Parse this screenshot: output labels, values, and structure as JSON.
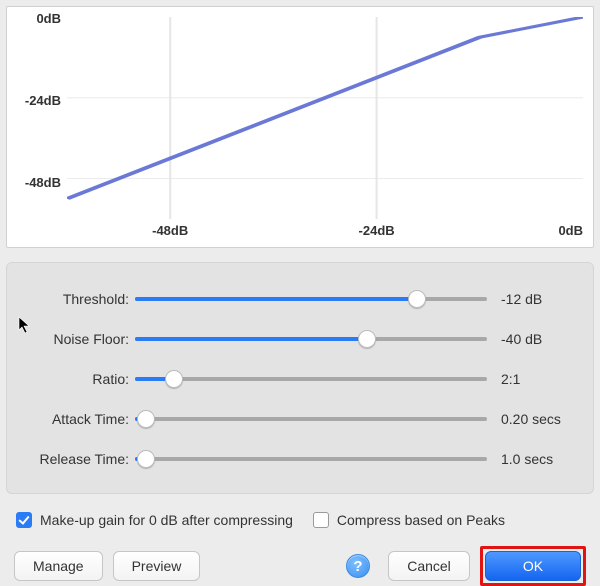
{
  "graph": {
    "y_ticks": [
      "0dB",
      "-24dB",
      "-48dB"
    ],
    "x_ticks": [
      "-48dB",
      "-24dB",
      "0dB"
    ],
    "x_range": [
      -60,
      0
    ],
    "y_range": [
      -60,
      0
    ],
    "line_points": [
      {
        "x": -60,
        "y": -54
      },
      {
        "x": -12,
        "y": -6
      },
      {
        "x": 0,
        "y": 0
      }
    ]
  },
  "sliders": [
    {
      "id": "threshold",
      "label": "Threshold:",
      "value_text": "-12 dB",
      "fill_pct": 80,
      "thumb_pct": 80
    },
    {
      "id": "noise-floor",
      "label": "Noise Floor:",
      "value_text": "-40 dB",
      "fill_pct": 66,
      "thumb_pct": 66
    },
    {
      "id": "ratio",
      "label": "Ratio:",
      "value_text": "2:1",
      "fill_pct": 11,
      "thumb_pct": 11
    },
    {
      "id": "attack-time",
      "label": "Attack Time:",
      "value_text": "0.20 secs",
      "fill_pct": 3,
      "thumb_pct": 3
    },
    {
      "id": "release-time",
      "label": "Release Time:",
      "value_text": "1.0 secs",
      "fill_pct": 3,
      "thumb_pct": 3
    }
  ],
  "checks": {
    "makeup": {
      "label": "Make-up gain for 0 dB after compressing",
      "checked": true
    },
    "peaks": {
      "label": "Compress based on Peaks",
      "checked": false
    }
  },
  "buttons": {
    "manage": "Manage",
    "preview": "Preview",
    "help": "?",
    "cancel": "Cancel",
    "ok": "OK"
  },
  "colors": {
    "accent": "#2a7bf6",
    "line": "#6b79d6",
    "highlight": "#e11414"
  },
  "chart_data": {
    "type": "line",
    "title": "",
    "xlabel": "",
    "ylabel": "",
    "xlim": [
      -60,
      0
    ],
    "ylim": [
      -60,
      0
    ],
    "x_ticks": [
      -48,
      -24,
      0
    ],
    "y_ticks": [
      0,
      -24,
      -48
    ],
    "series": [
      {
        "name": "transfer-curve",
        "points": [
          {
            "x": -60,
            "y": -54
          },
          {
            "x": -12,
            "y": -6
          },
          {
            "x": 0,
            "y": 0
          }
        ]
      }
    ]
  }
}
